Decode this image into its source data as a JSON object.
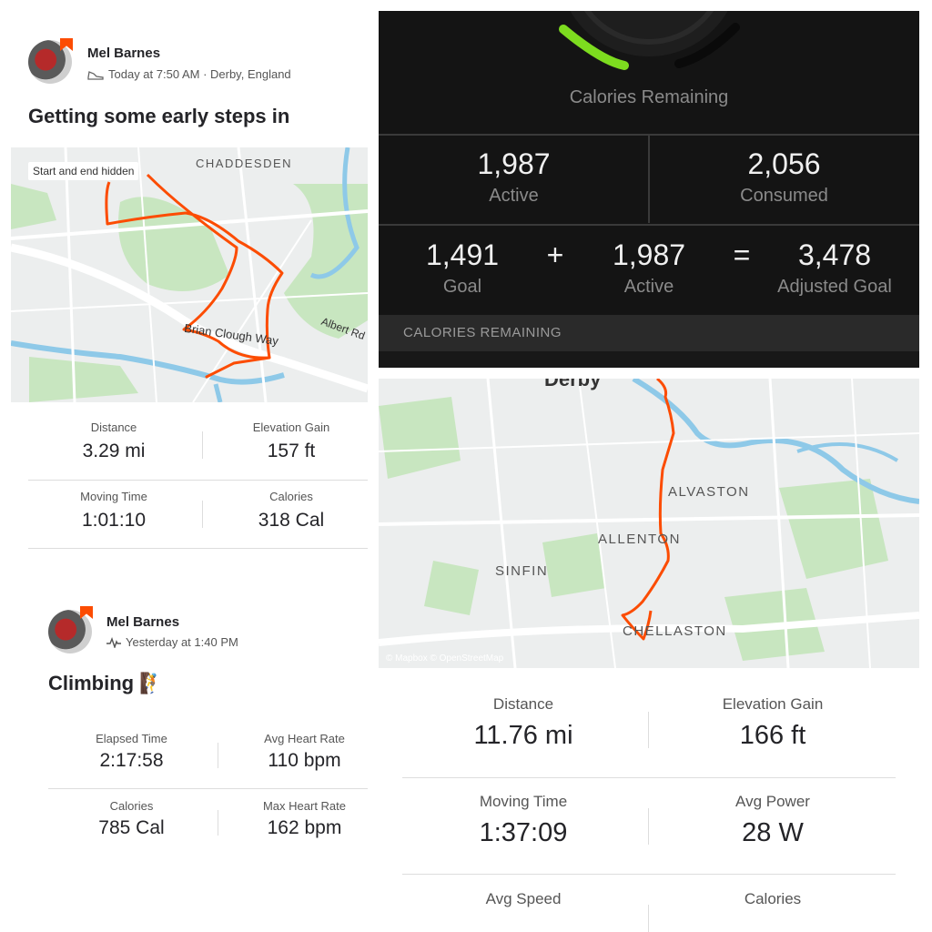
{
  "activity1": {
    "user_name": "Mel Barnes",
    "meta": "Today at 7:50 AM · Derby, England",
    "title": "Getting some early steps in",
    "map_tag": "Start and end hidden",
    "map_labels": [
      "CHADDESDEN",
      "Brian Clough Way",
      "Albert Rd"
    ],
    "stats": [
      {
        "label": "Distance",
        "value": "3.29 mi"
      },
      {
        "label": "Elevation Gain",
        "value": "157 ft"
      },
      {
        "label": "Moving Time",
        "value": "1:01:10"
      },
      {
        "label": "Calories",
        "value": "318 Cal"
      }
    ]
  },
  "activity2": {
    "user_name": "Mel Barnes",
    "meta": "Yesterday at 1:40 PM",
    "title": "Climbing 🧗",
    "stats": [
      {
        "label": "Elapsed Time",
        "value": "2:17:58"
      },
      {
        "label": "Avg Heart Rate",
        "value": "110 bpm"
      },
      {
        "label": "Calories",
        "value": "785 Cal"
      },
      {
        "label": "Max Heart Rate",
        "value": "162 bpm"
      }
    ]
  },
  "calories_app": {
    "remaining_label": "Calories Remaining",
    "active_value": "1,987",
    "active_label": "Active",
    "consumed_value": "2,056",
    "consumed_label": "Consumed",
    "goal_value": "1,491",
    "goal_label": "Goal",
    "plus_sign": "+",
    "active2_value": "1,987",
    "active2_label": "Active",
    "equals_sign": "=",
    "adjusted_value": "3,478",
    "adjusted_label": "Adjusted Goal",
    "section_header": "CALORIES REMAINING",
    "ring_color": "#7ddc1f"
  },
  "activity3": {
    "map_labels": [
      "Derby",
      "ALVASTON",
      "ALLENTON",
      "SINFIN",
      "CHELLASTON"
    ],
    "attribution": "© Mapbox © OpenStreetMap",
    "stats": [
      {
        "label": "Distance",
        "value": "11.76 mi"
      },
      {
        "label": "Elevation Gain",
        "value": "166 ft"
      },
      {
        "label": "Moving Time",
        "value": "1:37:09"
      },
      {
        "label": "Avg Power",
        "value": "28 W"
      },
      {
        "label": "Avg Speed",
        "value": ""
      },
      {
        "label": "Calories",
        "value": ""
      }
    ]
  },
  "colors": {
    "route": "#fc4c02",
    "brand": "#fc4c02"
  }
}
